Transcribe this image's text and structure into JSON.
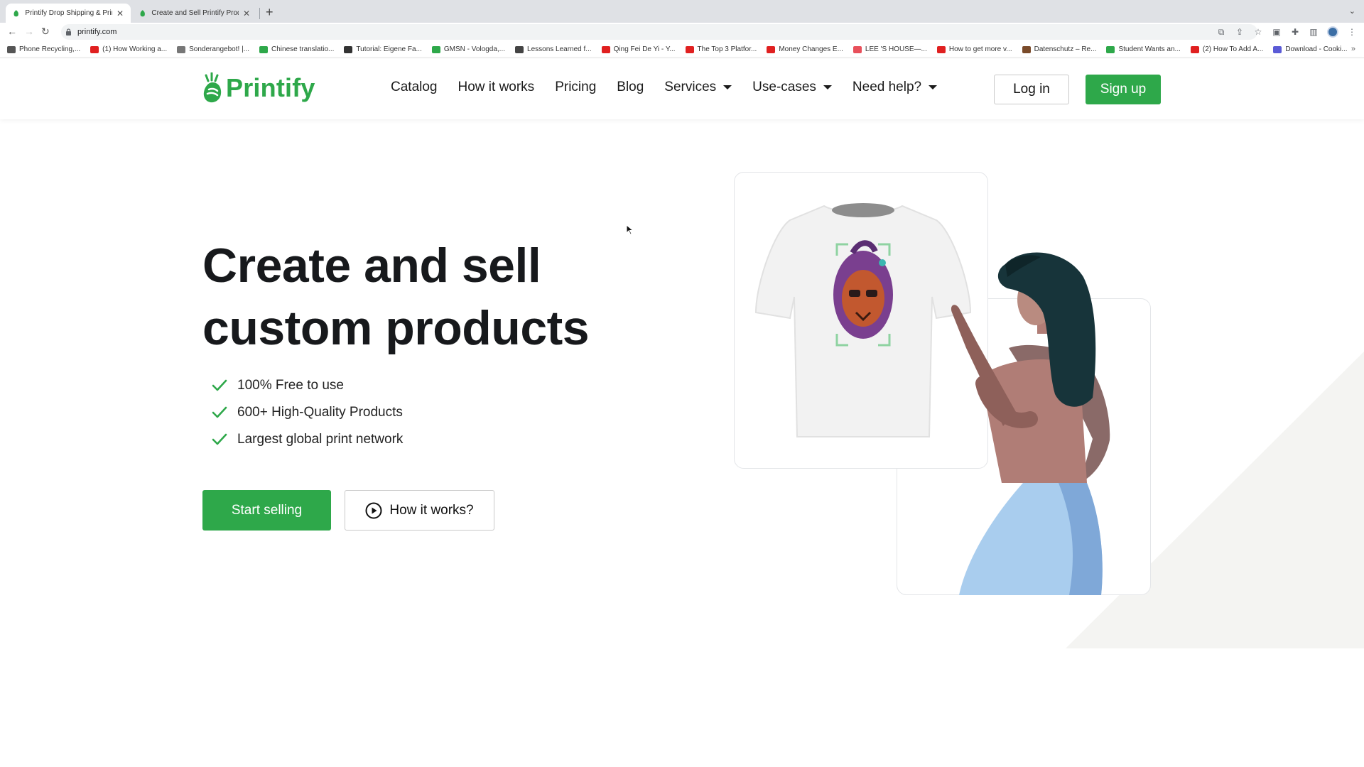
{
  "browser": {
    "tabs": [
      {
        "title": "Printify Drop Shipping & Printin",
        "active": true
      },
      {
        "title": "Create and Sell Printify Produc",
        "active": false
      }
    ],
    "url": "printify.com",
    "bookmarks": [
      {
        "label": "Phone Recycling,...",
        "icon_color": "#555555"
      },
      {
        "label": "(1) How Working a...",
        "icon_color": "#e02020"
      },
      {
        "label": "Sonderangebot! |...",
        "icon_color": "#777777"
      },
      {
        "label": "Chinese translatio...",
        "icon_color": "#2ea84a"
      },
      {
        "label": "Tutorial: Eigene Fa...",
        "icon_color": "#333333"
      },
      {
        "label": "GMSN - Vologda,...",
        "icon_color": "#2ea84a"
      },
      {
        "label": "Lessons Learned f...",
        "icon_color": "#444444"
      },
      {
        "label": "Qing Fei De Yi - Y...",
        "icon_color": "#e02020"
      },
      {
        "label": "The Top 3 Platfor...",
        "icon_color": "#e02020"
      },
      {
        "label": "Money Changes E...",
        "icon_color": "#e02020"
      },
      {
        "label": "LEE 'S HOUSE—...",
        "icon_color": "#e8505b"
      },
      {
        "label": "How to get more v...",
        "icon_color": "#e02020"
      },
      {
        "label": "Datenschutz – Re...",
        "icon_color": "#7a4b2a"
      },
      {
        "label": "Student Wants an...",
        "icon_color": "#2ea84a"
      },
      {
        "label": "(2) How To Add A...",
        "icon_color": "#e02020"
      },
      {
        "label": "Download - Cooki...",
        "icon_color": "#5b5bd6"
      }
    ],
    "more": "»"
  },
  "header": {
    "logo": "Printify",
    "nav": [
      {
        "label": "Catalog",
        "dropdown": false
      },
      {
        "label": "How it works",
        "dropdown": false
      },
      {
        "label": "Pricing",
        "dropdown": false
      },
      {
        "label": "Blog",
        "dropdown": false
      },
      {
        "label": "Services",
        "dropdown": true
      },
      {
        "label": "Use-cases",
        "dropdown": true
      },
      {
        "label": "Need help?",
        "dropdown": true
      }
    ],
    "login": "Log in",
    "signup": "Sign up"
  },
  "hero": {
    "title_line1": "Create and sell",
    "title_line2": "custom products",
    "features": [
      "100% Free to use",
      "600+ High-Quality Products",
      "Largest global print network"
    ],
    "cta_primary": "Start selling",
    "cta_secondary": "How it works?"
  },
  "colors": {
    "brand_green": "#2ea84a",
    "text_dark": "#17191c",
    "tab_bar": "#dfe1e5"
  }
}
